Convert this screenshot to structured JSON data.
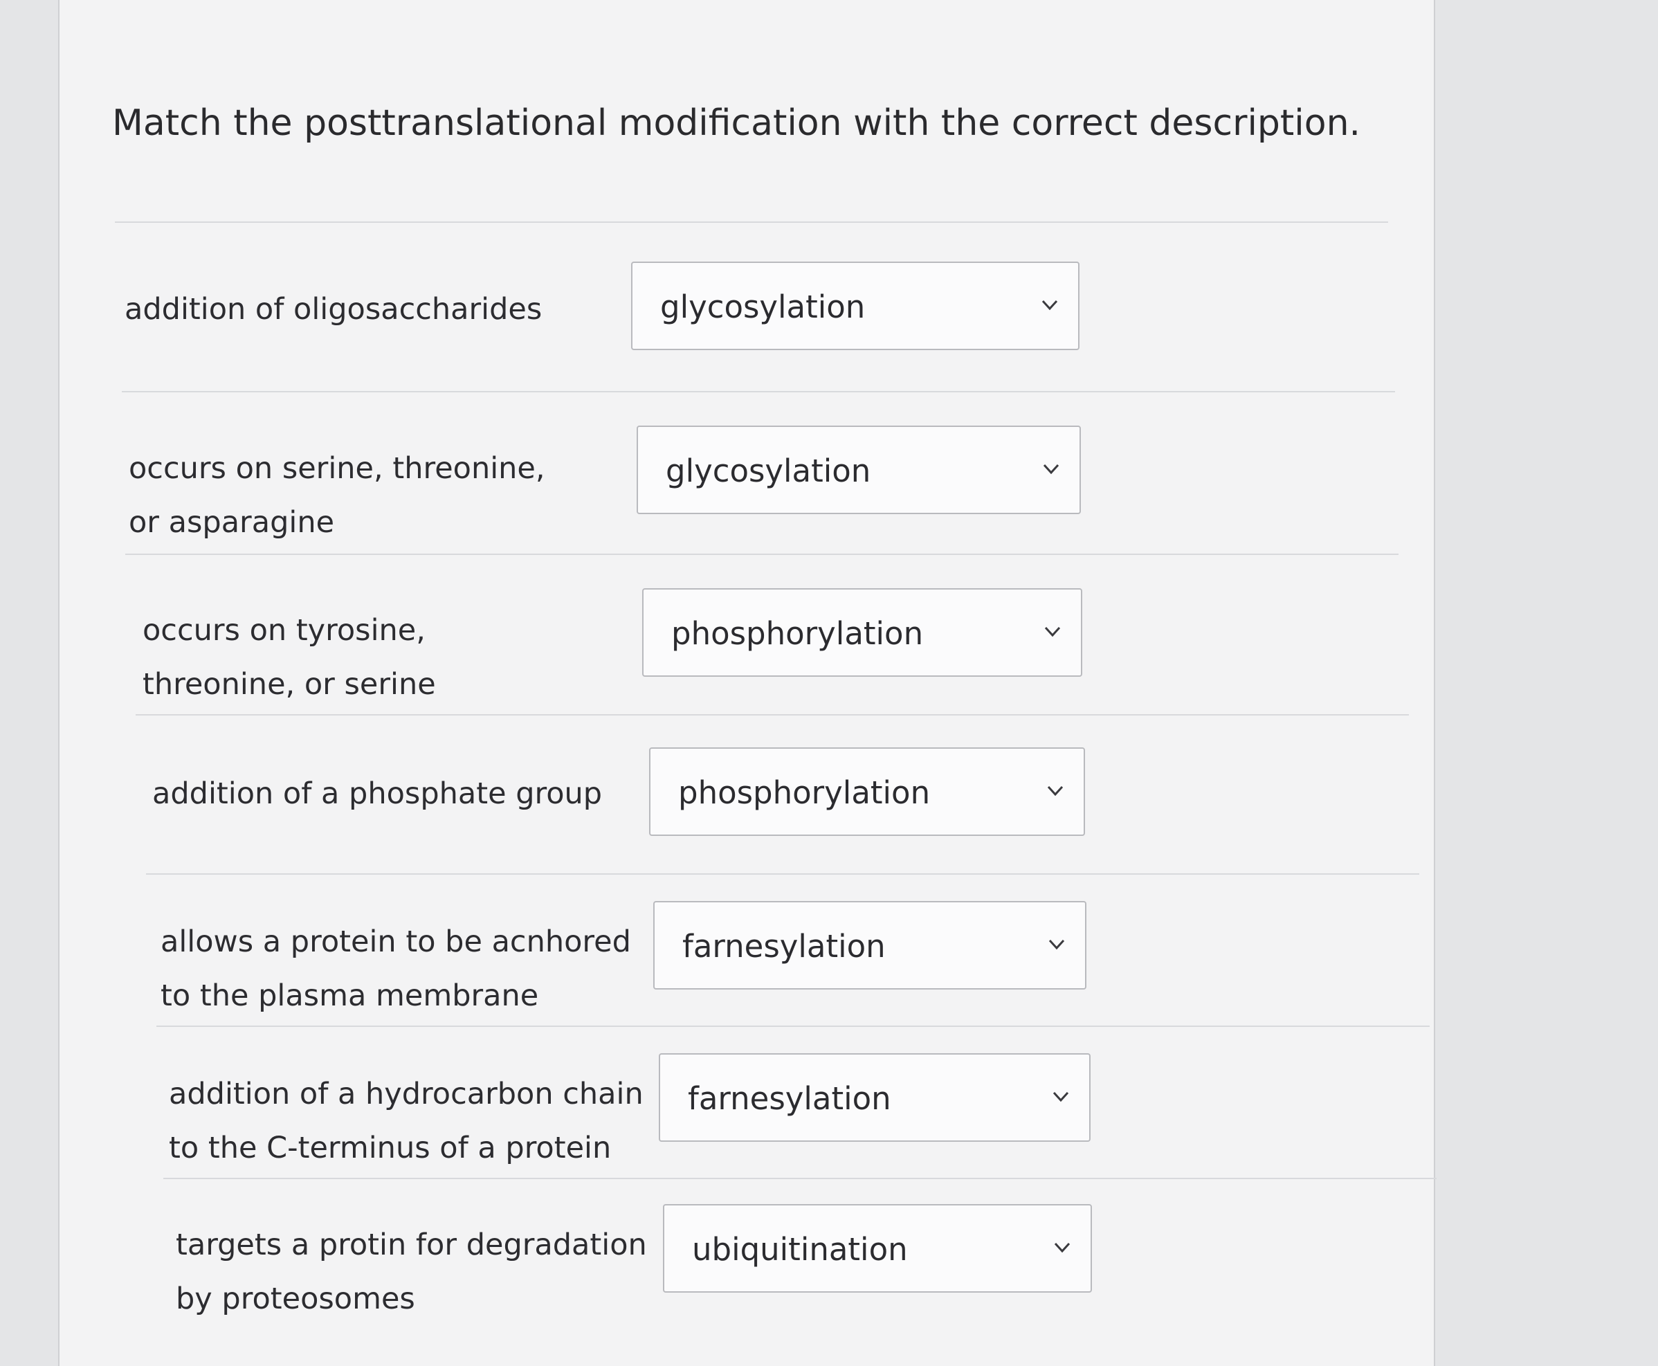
{
  "question": {
    "title": "Match the posttranslational modification with the correct description."
  },
  "rows": [
    {
      "prompt": "addition of oligosaccharides",
      "selected": "glycosylation"
    },
    {
      "prompt": "occurs on serine, threonine, or asparagine",
      "selected": "glycosylation"
    },
    {
      "prompt": "occurs on tyrosine, threonine, or serine",
      "selected": "phosphorylation"
    },
    {
      "prompt": "addition of a phosphate group",
      "selected": "phosphorylation"
    },
    {
      "prompt": "allows a protein to be acnhored to the plasma membrane",
      "selected": "farnesylation"
    },
    {
      "prompt": "addition of a hydrocarbon chain to the C-terminus of a protein",
      "selected": "farnesylation"
    },
    {
      "prompt": "targets a protin for degradation by proteosomes",
      "selected": "ubiquitination"
    }
  ],
  "icons": {
    "dropdown": "chevron-down-icon"
  },
  "colors": {
    "panel": "#f3f3f4",
    "border": "#b9babe",
    "background": "#e4e5e7"
  }
}
